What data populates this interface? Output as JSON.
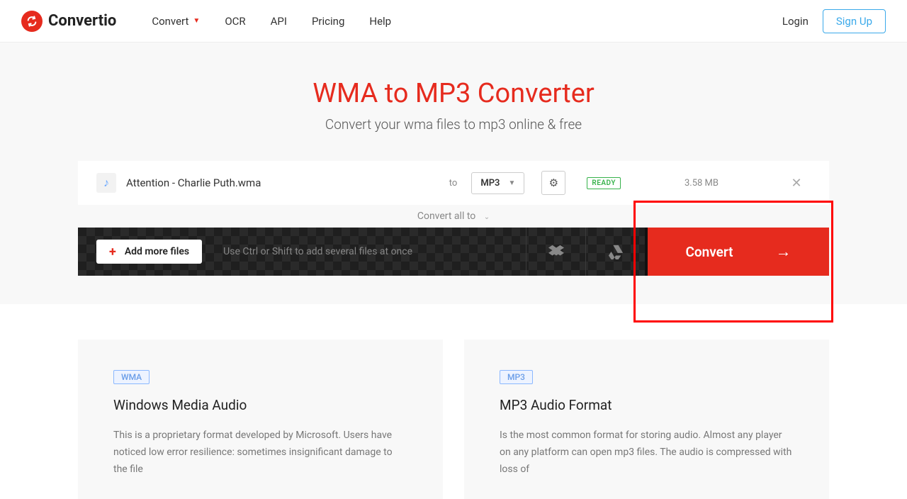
{
  "brand": {
    "name": "Convertio"
  },
  "nav": {
    "convert": "Convert",
    "ocr": "OCR",
    "api": "API",
    "pricing": "Pricing",
    "help": "Help"
  },
  "auth": {
    "login": "Login",
    "signup": "Sign Up"
  },
  "page": {
    "title": "WMA to MP3 Converter",
    "subtitle": "Convert your wma files to mp3 online & free"
  },
  "file": {
    "name": "Attention - Charlie Puth.wma",
    "to_label": "to",
    "target_format": "MP3",
    "status": "READY",
    "size": "3.58 MB"
  },
  "convert_all": {
    "label": "Convert all to"
  },
  "actions": {
    "add_more": "Add more files",
    "hint": "Use Ctrl or Shift to add several files at once",
    "convert": "Convert"
  },
  "cards": {
    "left": {
      "badge": "WMA",
      "title": "Windows Media Audio",
      "desc": "This is a proprietary format developed by Microsoft. Users have noticed low error resilience: sometimes insignificant damage to the file"
    },
    "right": {
      "badge": "MP3",
      "title": "MP3 Audio Format",
      "desc": "Is the most common format for storing audio. Almost any player on any platform can open mp3 files. The audio is compressed with loss of"
    }
  },
  "colors": {
    "accent": "#e62b1e",
    "link": "#3aa9ea"
  }
}
